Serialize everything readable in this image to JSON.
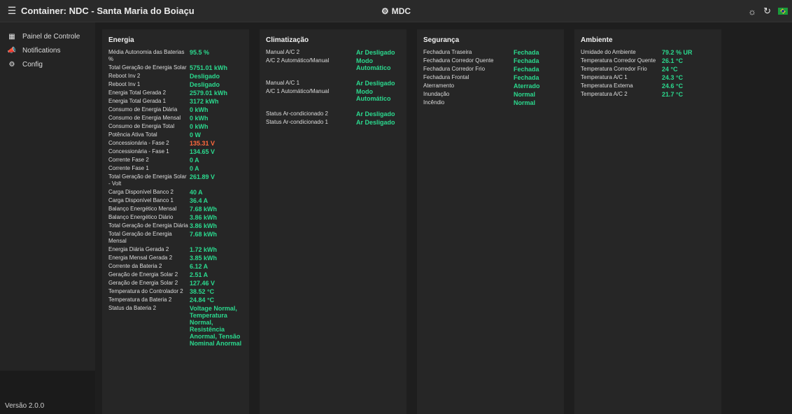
{
  "header": {
    "title": "Container: NDC - Santa Maria do Boiaçu",
    "center_title": "MDC"
  },
  "sidebar": {
    "items": [
      {
        "label": "Painel de Controle",
        "icon": "dashboard-icon"
      },
      {
        "label": "Notifications",
        "icon": "megaphone-icon"
      },
      {
        "label": "Config",
        "icon": "gear-icon"
      }
    ],
    "version": "Versão 2.0.0"
  },
  "cards": {
    "energia": {
      "title": "Energia",
      "rows": [
        {
          "label": "Média Autonomia das Baterias %",
          "value": "95.5 %"
        },
        {
          "label": "Total Geração de Energia Solar",
          "value": "5751.01 kWh"
        },
        {
          "label": "Reboot Inv 2",
          "value": "Desligado"
        },
        {
          "label": "Reboot Inv 1",
          "value": "Desligado"
        },
        {
          "label": "Energia Total Gerada 2",
          "value": "2579.01 kWh"
        },
        {
          "label": "Energia Total Gerada 1",
          "value": "3172 kWh"
        },
        {
          "label": "Consumo de Energia Diária",
          "value": "0 kWh"
        },
        {
          "label": "Consumo de Energia Mensal",
          "value": "0 kWh"
        },
        {
          "label": "Consumo de Energia Total",
          "value": "0 kWh"
        },
        {
          "label": "Potência Ativa Total",
          "value": "0 W"
        },
        {
          "label": "Concessionária - Fase 2",
          "value": "135.31 V"
        },
        {
          "label": "Concessionária - Fase 1",
          "value": "134.65 V"
        },
        {
          "label": "Corrente Fase 2",
          "value": "0 A"
        },
        {
          "label": "Corrente Fase 1",
          "value": "0 A"
        },
        {
          "label": "Total Geração de Energia Solar - Volt",
          "value": "261.89 V"
        },
        {
          "label": "Carga Disponível Banco 2",
          "value": "40 A"
        },
        {
          "label": "Carga Disponível Banco 1",
          "value": "36.4 A"
        },
        {
          "label": "Balanço Energético Mensal",
          "value": "7.68 kWh"
        },
        {
          "label": "Balanço Energético Diário",
          "value": "3.86 kWh"
        },
        {
          "label": "Total Geração de Energia Diária",
          "value": "3.86 kWh"
        },
        {
          "label": "Total Geração de Energia Mensal",
          "value": "7.68 kWh"
        },
        {
          "label": "Energia Diária Gerada 2",
          "value": "1.72 kWh"
        },
        {
          "label": "Energia Mensal Gerada 2",
          "value": "3.85 kWh"
        },
        {
          "label": "Corrente da Bateria 2",
          "value": "6.12 A"
        },
        {
          "label": "Geração de Energia Solar 2",
          "value": "2.51 A"
        },
        {
          "label": "Geração de Energia Solar 2",
          "value": "127.46 V"
        },
        {
          "label": "Temperatura do Controlador 2",
          "value": "38.52 °C"
        },
        {
          "label": "Temperatura da Bateria 2",
          "value": "24.84 °C"
        },
        {
          "label": "Status da Bateria 2",
          "value": "Voltage Normal, Temperatura Normal, Resistência Anormal, Tensão Nominal Anormal"
        }
      ]
    },
    "climatizacao": {
      "title": "Climatização",
      "rows": [
        {
          "label": "Manual A/C 2",
          "value": "Ar Desligado"
        },
        {
          "label": "A/C 2 Automático/Manual",
          "value": "Modo Automático"
        },
        {
          "label": "Manual A/C 1",
          "value": "Ar Desligado"
        },
        {
          "label": "A/C 1 Automático/Manual",
          "value": "Modo Automático"
        },
        {
          "label": "Status Ar-condicionado 2",
          "value": "Ar Desligado"
        },
        {
          "label": "Status Ar-condicionado 1",
          "value": "Ar Desligado"
        }
      ]
    },
    "seguranca": {
      "title": "Segurança",
      "rows": [
        {
          "label": "Fechadura Traseira",
          "value": "Fechada"
        },
        {
          "label": "Fechadura Corredor Quente",
          "value": "Fechada"
        },
        {
          "label": "Fechadura Corredor Frio",
          "value": "Fechada"
        },
        {
          "label": "Fechadura Frontal",
          "value": "Fechada"
        },
        {
          "label": "Aterramento",
          "value": "Aterrado"
        },
        {
          "label": "Inundação",
          "value": "Normal"
        },
        {
          "label": "Incêndio",
          "value": "Normal"
        }
      ]
    },
    "ambiente": {
      "title": "Ambiente",
      "rows": [
        {
          "label": "Umidade do Ambiente",
          "value": "79.2 % UR"
        },
        {
          "label": "Temperatura Corredor Quente",
          "value": "26.1 °C"
        },
        {
          "label": "Temperatura Corredor Frio",
          "value": "24 °C"
        },
        {
          "label": "Temperatura A/C 1",
          "value": "24.3 °C"
        },
        {
          "label": "Temperatura Externa",
          "value": "24.6 °C"
        },
        {
          "label": "Temperatura A/C 2",
          "value": "21.7 °C"
        }
      ]
    }
  },
  "colors": {
    "value_ok": "#2bd98e",
    "value_warn": "#ff6a3d",
    "card_bg": "#262626",
    "page_bg": "#1e1e1e"
  }
}
